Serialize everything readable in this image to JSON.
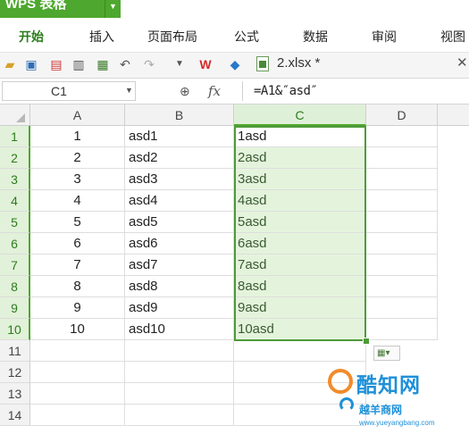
{
  "app": {
    "name": "WPS 表格"
  },
  "menu": [
    "开始",
    "插入",
    "页面布局",
    "公式",
    "数据",
    "审阅",
    "视图"
  ],
  "document": {
    "tab_title": "2.xlsx *"
  },
  "formula_bar": {
    "name_box": "C1",
    "formula": "=A1&″asd″",
    "fx_label": "fx"
  },
  "columns": [
    "A",
    "B",
    "C",
    "D"
  ],
  "rows": [
    "1",
    "2",
    "3",
    "4",
    "5",
    "6",
    "7",
    "8",
    "9",
    "10",
    "11",
    "12",
    "13",
    "14"
  ],
  "data": [
    [
      "1",
      "asd1",
      "1asd"
    ],
    [
      "2",
      "asd2",
      "2asd"
    ],
    [
      "3",
      "asd3",
      "3asd"
    ],
    [
      "4",
      "asd4",
      "4asd"
    ],
    [
      "5",
      "asd5",
      "5asd"
    ],
    [
      "6",
      "asd6",
      "6asd"
    ],
    [
      "7",
      "asd7",
      "7asd"
    ],
    [
      "8",
      "asd8",
      "8asd"
    ],
    [
      "9",
      "asd9",
      "9asd"
    ],
    [
      "10",
      "asd10",
      "10asd"
    ]
  ],
  "watermark": {
    "title": "酷知网",
    "subtitle": "越羊商网",
    "url": "www.yueyangbang.com"
  },
  "colors": {
    "accent": "#4ea72e",
    "selection": "#e4f4dc"
  }
}
